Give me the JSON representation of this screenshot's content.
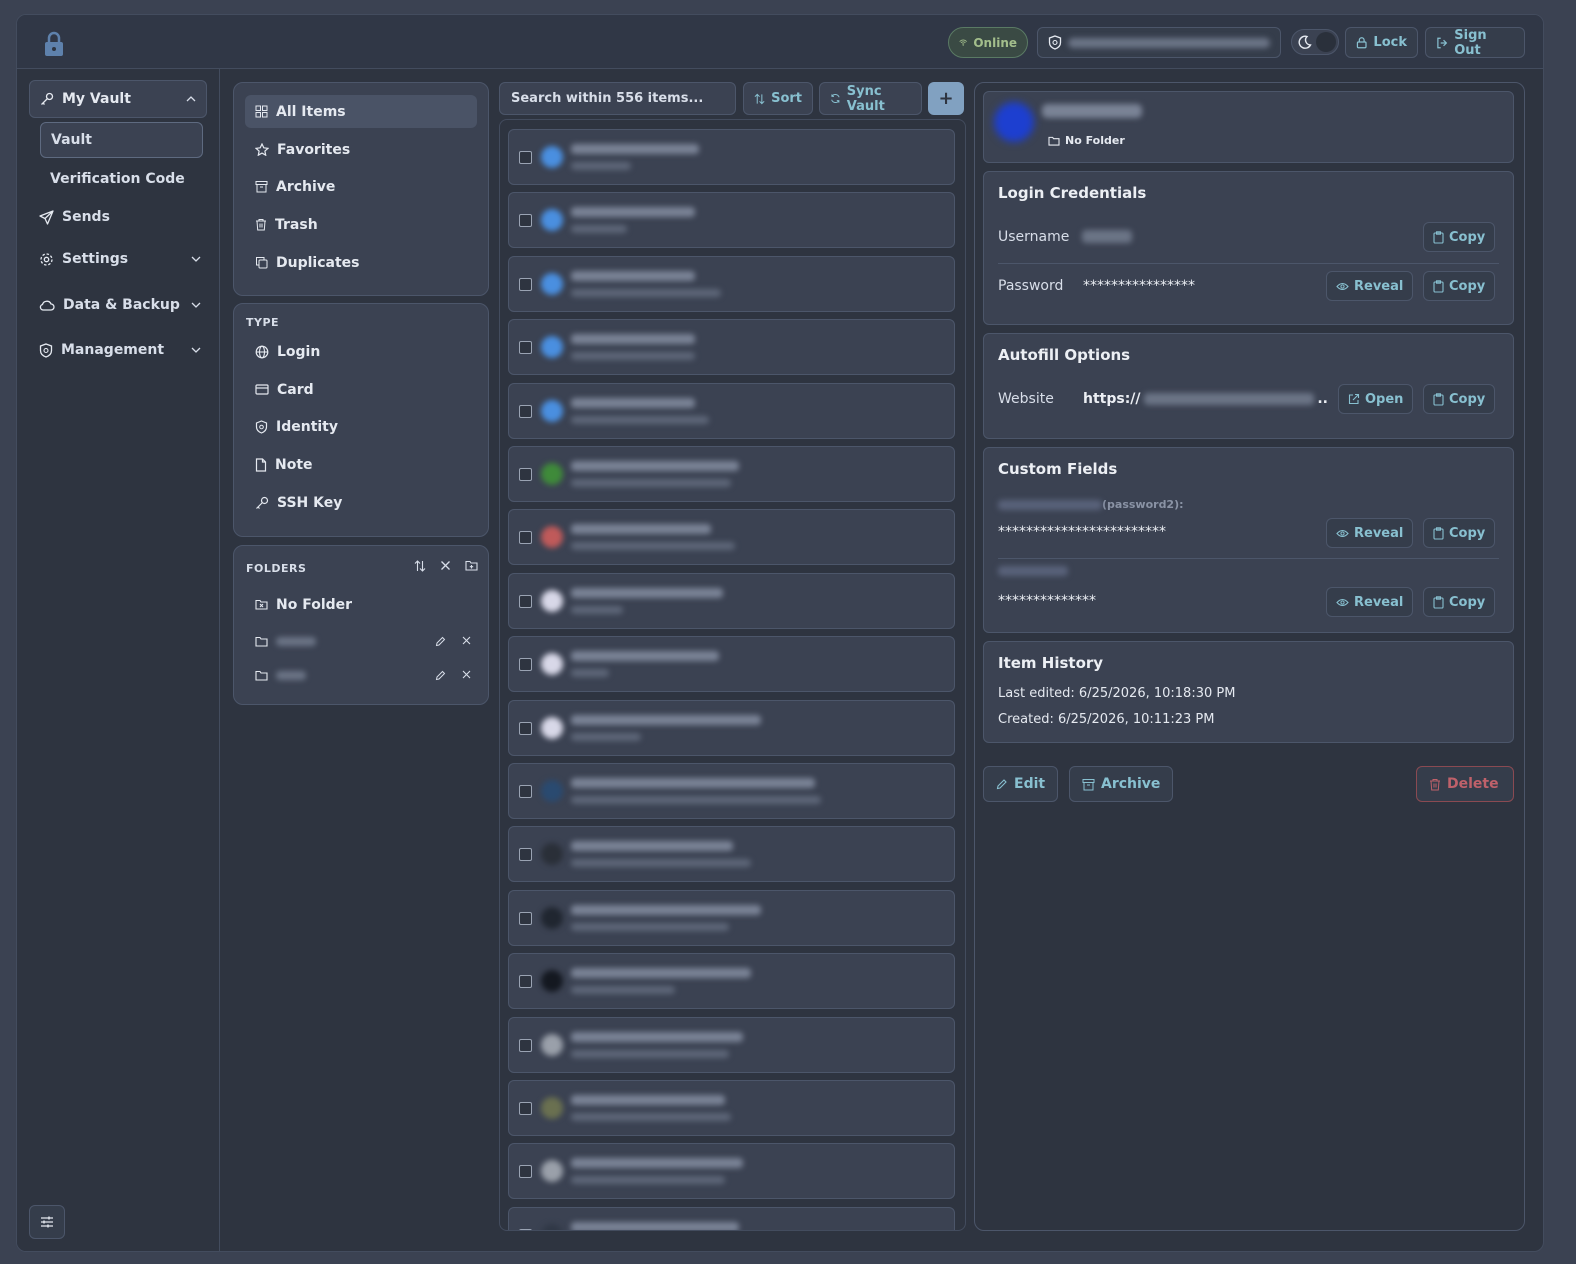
{
  "topbar": {
    "status": "Online",
    "lock_label": "Lock",
    "signout_label": "Sign Out"
  },
  "sidebar": {
    "group_label": "My Vault",
    "sub_items": [
      "Vault",
      "Verification Code"
    ],
    "items": [
      "Sends",
      "Settings",
      "Data & Backup",
      "Management"
    ]
  },
  "filters": {
    "items": [
      "All Items",
      "Favorites",
      "Archive",
      "Trash",
      "Duplicates"
    ],
    "type_label": "TYPE",
    "types": [
      "Login",
      "Card",
      "Identity",
      "Note",
      "SSH Key"
    ],
    "folders_label": "FOLDERS",
    "no_folder": "No Folder"
  },
  "list": {
    "search_placeholder": "Search within 556 items...",
    "sort_label": "Sort",
    "sync_label": "Sync Vault",
    "add_label": "+",
    "rows": [
      {
        "icon_color": "#4a8fe0"
      },
      {
        "icon_color": "#4a8fe0"
      },
      {
        "icon_color": "#4a8fe0"
      },
      {
        "icon_color": "#4a8fe0"
      },
      {
        "icon_color": "#4a8fe0"
      },
      {
        "icon_color": "#3f8a3a"
      },
      {
        "icon_color": "#c05a5a"
      },
      {
        "icon_color": "#d8d8e8"
      },
      {
        "icon_color": "#d8d8e8"
      },
      {
        "icon_color": "#d8d8e8"
      },
      {
        "icon_color": "#2a4a70"
      },
      {
        "icon_color": "#2a2f38"
      },
      {
        "icon_color": "#202630"
      },
      {
        "icon_color": "#141820"
      },
      {
        "icon_color": "#9aa0aa"
      },
      {
        "icon_color": "#6a7050"
      },
      {
        "icon_color": "#9aa0aa"
      },
      {
        "icon_color": "#303846"
      }
    ]
  },
  "detail": {
    "folder": "No Folder",
    "login": {
      "title": "Login Credentials",
      "username_label": "Username",
      "password_label": "Password",
      "password_value": "****************",
      "copy": "Copy",
      "reveal": "Reveal"
    },
    "autofill": {
      "title": "Autofill Options",
      "website_label": "Website",
      "website_prefix": "https://",
      "website_suffix": "..",
      "open": "Open",
      "copy": "Copy"
    },
    "custom": {
      "title": "Custom Fields",
      "field1_suffix": "(password2):",
      "field1_value": "************************",
      "field2_value": "**************",
      "reveal": "Reveal",
      "copy": "Copy"
    },
    "history": {
      "title": "Item History",
      "last_edited": "Last edited: 6/25/2026, 10:18:30 PM",
      "created": "Created: 6/25/2026, 10:11:23 PM"
    },
    "actions": {
      "edit": "Edit",
      "archive": "Archive",
      "delete": "Delete"
    }
  }
}
